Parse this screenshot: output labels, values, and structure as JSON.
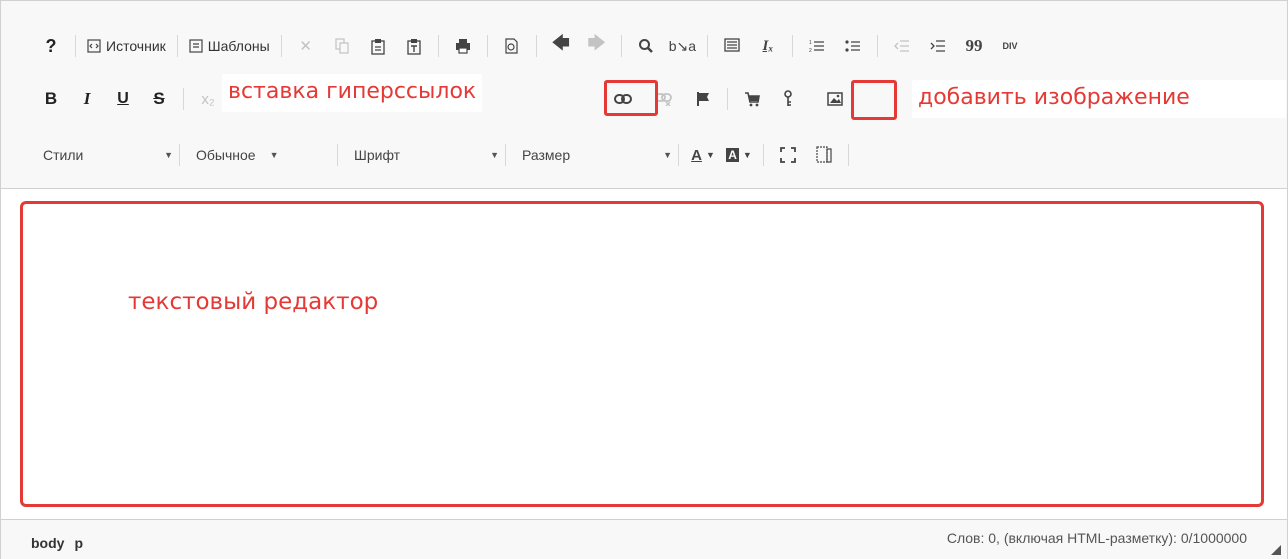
{
  "toolbar": {
    "help_label": "?",
    "source_label": "Источник",
    "templates_label": "Шаблоны",
    "blockquote_glyph": "99",
    "div_glyph": "DIV",
    "bold_label": "B",
    "italic_label": "I",
    "underline_label": "U",
    "strike_label": "S",
    "combos": {
      "styles": "Стили",
      "format": "Обычное",
      "font": "Шрифт",
      "size": "Размер"
    },
    "text_color_label": "A",
    "bg_color_label": "A"
  },
  "annotations": {
    "hyperlinks": "вставка гиперссылок",
    "image": "добавить изображение",
    "editor": "текстовый редактор"
  },
  "status_bar": {
    "path": [
      "body",
      "p"
    ],
    "word_count": "Слов: 0, (включая HTML-разметку): 0/1000000"
  },
  "colors": {
    "annotation": "#e53935",
    "toolbar_bg": "#f8f8f8",
    "border": "#d1d1d1",
    "icon": "#444444",
    "disabled_icon": "#c3c3c3"
  }
}
